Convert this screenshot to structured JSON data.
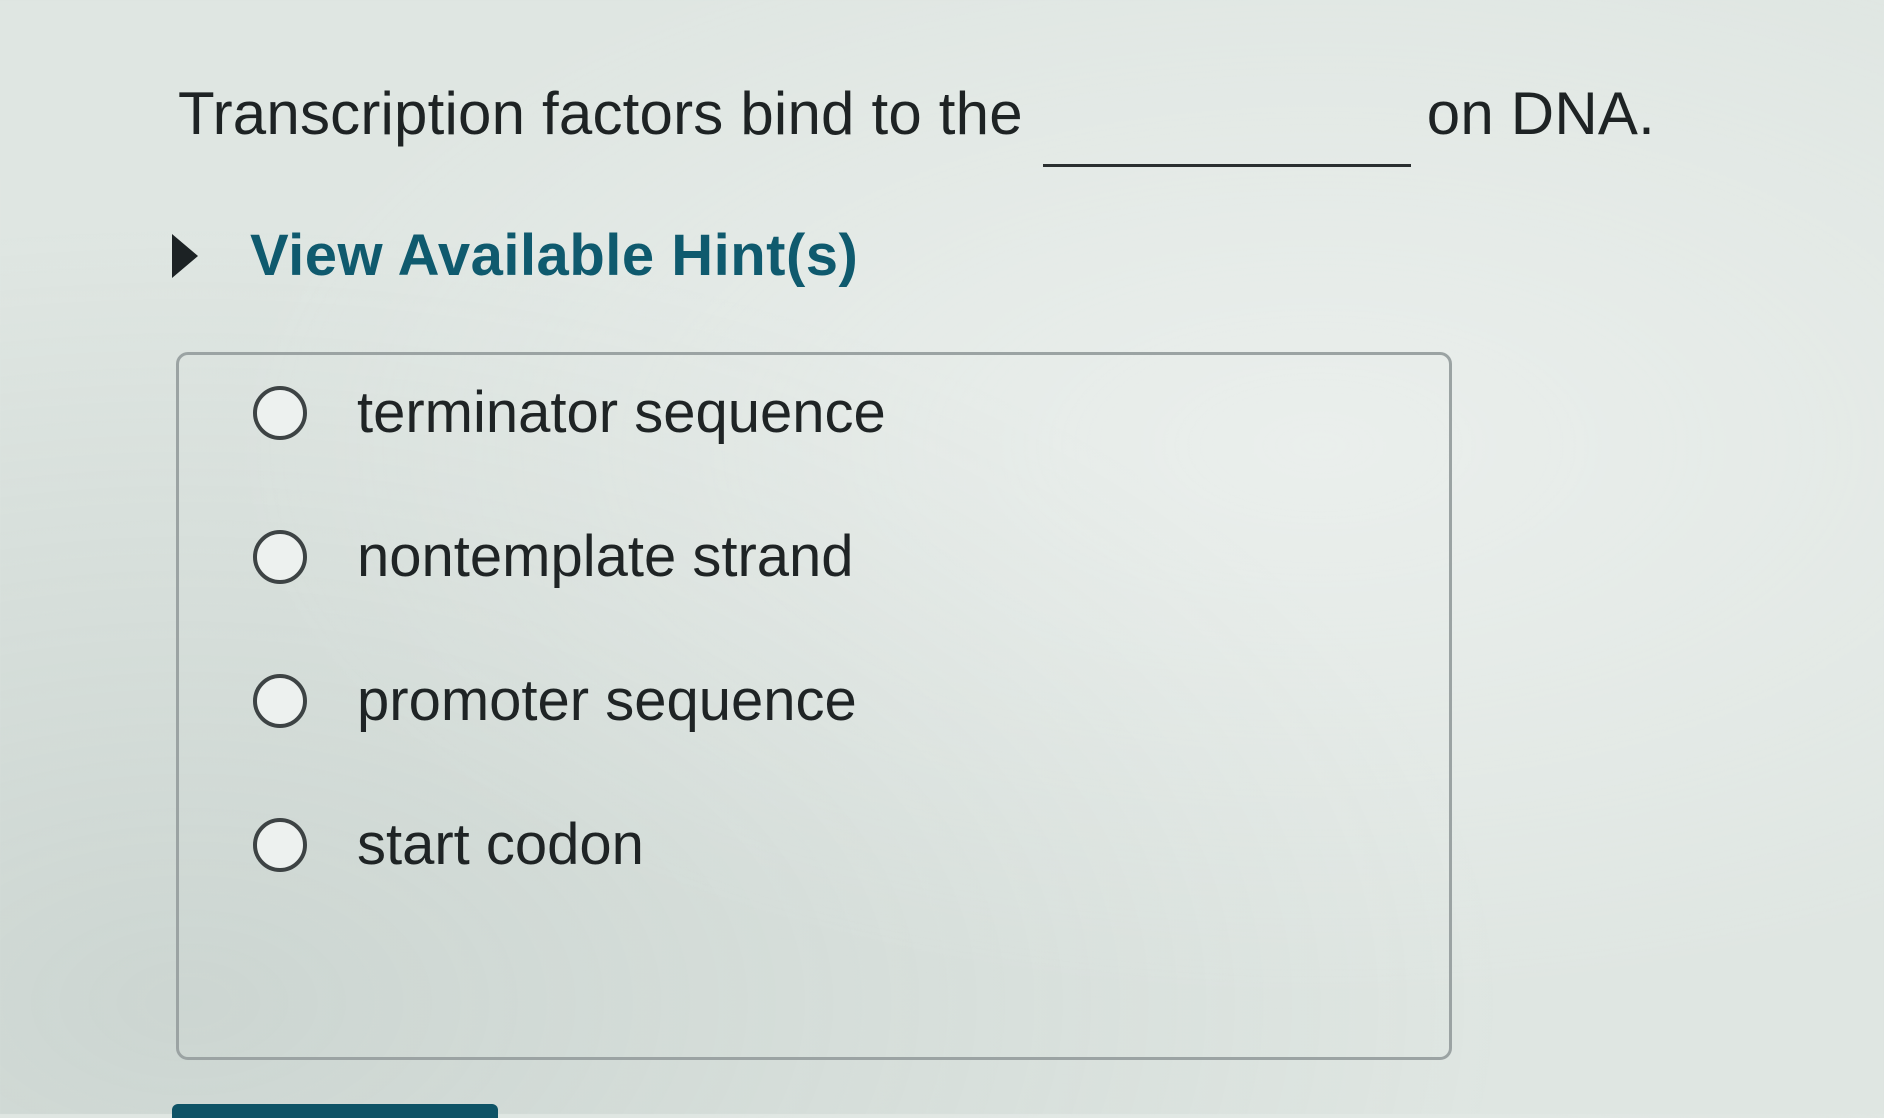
{
  "question": {
    "before_blank": "Transcription factors bind to the",
    "after_blank": "on DNA."
  },
  "hints": {
    "label": "View Available Hint(s)",
    "icon": "caret-right-icon"
  },
  "options": [
    {
      "label": "terminator sequence",
      "selected": false
    },
    {
      "label": "nontemplate strand",
      "selected": false
    },
    {
      "label": "promoter sequence",
      "selected": false
    },
    {
      "label": "start codon",
      "selected": false
    }
  ],
  "colors": {
    "hint_accent": "#0f5a6e",
    "submit_accent": "#0e5366",
    "text": "#1e2324"
  }
}
